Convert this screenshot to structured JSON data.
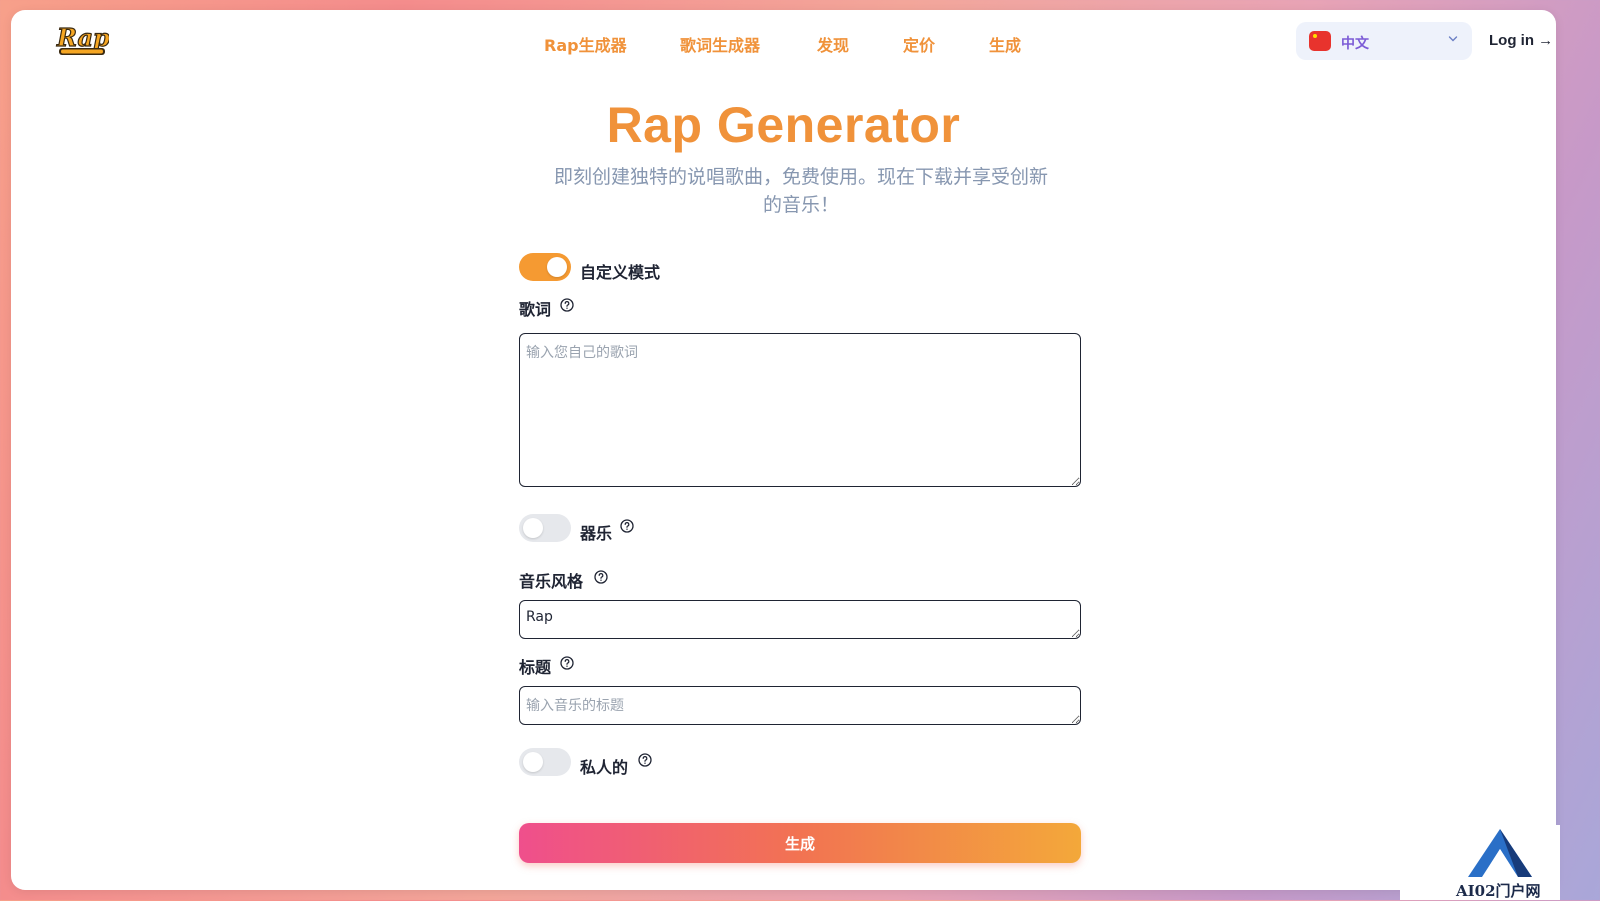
{
  "logo": {
    "text": "Rap Generator"
  },
  "nav": {
    "items": [
      "Rap生成器",
      "歌词生成器",
      "发现",
      "定价",
      "生成"
    ]
  },
  "language": {
    "label": "中文"
  },
  "login": {
    "label": "Log in →"
  },
  "hero": {
    "title": "Rap Generator",
    "subtitle": "即刻创建独特的说唱歌曲，免费使用。现在下载并享受创新的音乐！"
  },
  "form": {
    "custom_mode": {
      "label": "自定义模式",
      "on": true
    },
    "lyrics": {
      "label": "歌词",
      "placeholder": "输入您自己的歌词",
      "value": ""
    },
    "instrumental": {
      "label": "器乐",
      "on": false
    },
    "style": {
      "label": "音乐风格",
      "value": "Rap"
    },
    "title_field": {
      "label": "标题",
      "placeholder": "输入音乐的标题",
      "value": ""
    },
    "private": {
      "label": "私人的",
      "on": false
    },
    "submit_label": "生成"
  },
  "watermark": {
    "text": "AI02门户网"
  },
  "colors": {
    "accent": "#f0923a",
    "nav": "#f0923a",
    "subtitle": "#8797b0",
    "toggle_on": "#f59a32"
  }
}
